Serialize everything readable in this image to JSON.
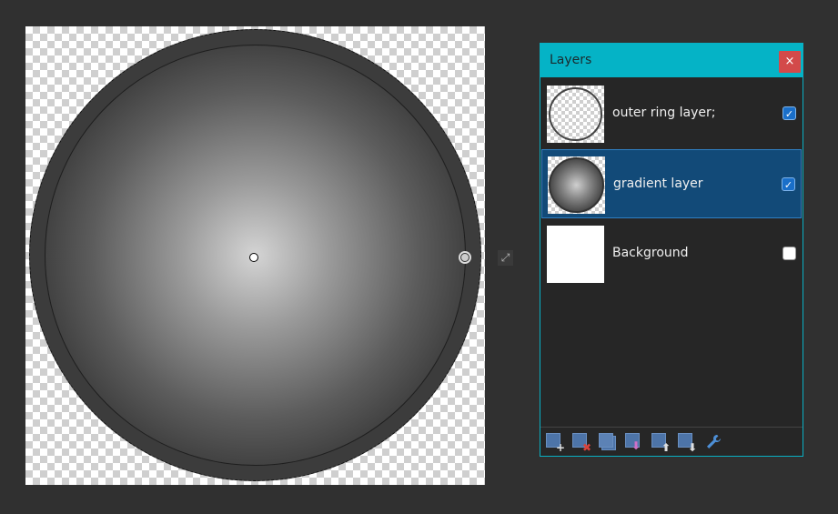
{
  "canvas": {
    "center_handle": "gradient-center-handle",
    "edge_handle": "gradient-radius-handle",
    "expand_icon": "expand-icon"
  },
  "layers_panel": {
    "title": "Layers",
    "close_label": "×",
    "layers": [
      {
        "name": "outer ring layer;",
        "visible": true,
        "selected": false,
        "thumb": "ring"
      },
      {
        "name": "gradient layer",
        "visible": true,
        "selected": true,
        "thumb": "gradient"
      },
      {
        "name": "Background",
        "visible": false,
        "selected": false,
        "thumb": "white"
      }
    ],
    "toolbar": [
      {
        "icon": "add-layer-icon",
        "symbol": "+",
        "color": "#e0e0e0"
      },
      {
        "icon": "delete-layer-icon",
        "symbol": "✖",
        "color": "#d9423a"
      },
      {
        "icon": "duplicate-layer-icon",
        "symbol": "",
        "color": ""
      },
      {
        "icon": "merge-down-icon",
        "symbol": "⬇",
        "color": "#d070c8"
      },
      {
        "icon": "move-up-icon",
        "symbol": "⬆",
        "color": "#e0e0e0"
      },
      {
        "icon": "move-down-icon",
        "symbol": "⬇",
        "color": "#e0e0e0"
      },
      {
        "icon": "properties-wrench-icon",
        "symbol": "🔧",
        "color": "#4d8fd6"
      }
    ]
  },
  "colors": {
    "panel_accent": "#05b3c6",
    "selected_row": "#124a78",
    "close_button": "#d34a4a"
  }
}
